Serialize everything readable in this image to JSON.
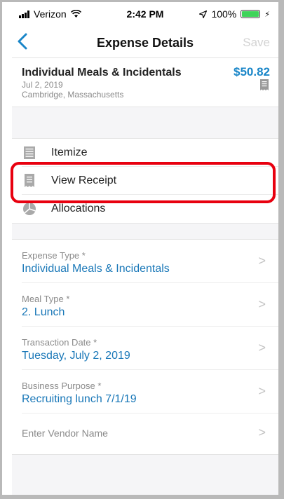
{
  "status_bar": {
    "carrier": "Verizon",
    "time": "2:42 PM",
    "battery": "100%",
    "battery_level": 1.0
  },
  "nav": {
    "back_glyph": "<",
    "title": "Expense Details",
    "save_label": "Save"
  },
  "summary": {
    "title": "Individual Meals & Incidentals",
    "date": "Jul 2, 2019",
    "location": "Cambridge, Massachusetts",
    "amount": "$50.82"
  },
  "menu": {
    "itemize": "Itemize",
    "view_receipt": "View Receipt",
    "allocations": "Allocations"
  },
  "fields": {
    "expense_type": {
      "label": "Expense Type *",
      "value": "Individual Meals & Incidentals"
    },
    "meal_type": {
      "label": "Meal Type *",
      "value": "2. Lunch"
    },
    "transaction_date": {
      "label": "Transaction Date *",
      "value": "Tuesday, July 2, 2019"
    },
    "business_purpose": {
      "label": "Business Purpose *",
      "value": "Recruiting lunch 7/1/19"
    },
    "vendor": {
      "placeholder": "Enter Vendor Name"
    }
  },
  "colors": {
    "accent": "#1a86c8",
    "highlight": "#e8000f",
    "battery": "#3fd45a"
  },
  "icons": {
    "back": "chevron-left-icon",
    "chevron": "chevron-right-icon",
    "itemize": "list-icon",
    "receipt": "receipt-icon",
    "allocations": "pie-chart-icon"
  }
}
